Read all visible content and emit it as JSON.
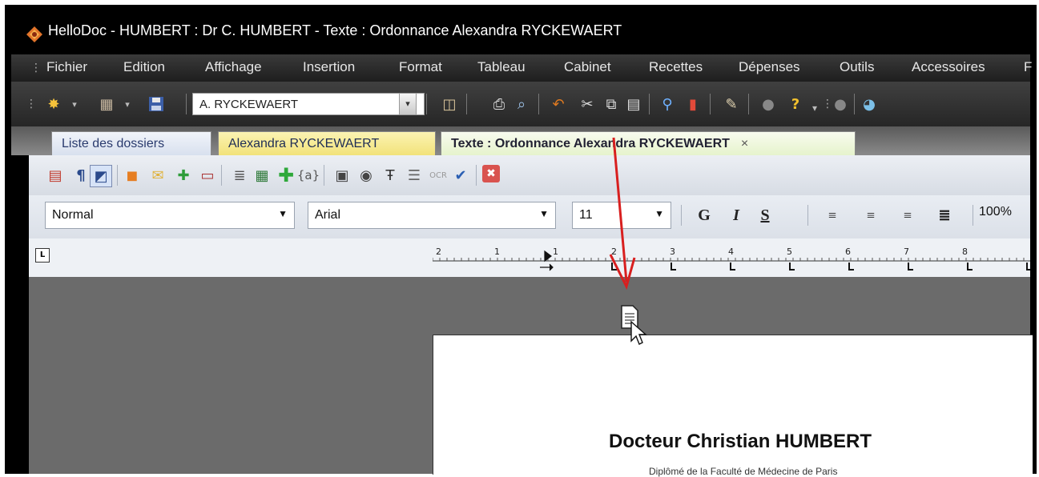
{
  "window": {
    "title": "HelloDoc - HUMBERT : Dr C. HUMBERT - Texte : Ordonnance Alexandra RYCKEWAERT"
  },
  "menu": {
    "items": [
      "Fichier",
      "Edition",
      "Affichage",
      "Insertion",
      "Format",
      "Tableau",
      "Cabinet",
      "Recettes",
      "Dépenses",
      "Outils",
      "Accessoires",
      "F"
    ]
  },
  "toolbar": {
    "patient_combo_value": "A. RYCKEWAERT"
  },
  "tabs": [
    {
      "label": "Liste des dossiers"
    },
    {
      "label": "Alexandra RYCKEWAERT"
    },
    {
      "label": "Texte : Ordonnance Alexandra RYCKEWAERT",
      "close": "×"
    }
  ],
  "format": {
    "style": "Normal",
    "font": "Arial",
    "size": "11",
    "bold": "G",
    "italic": "I",
    "underline": "S",
    "zoom": "100%"
  },
  "ruler": {
    "tab_selector": "L",
    "labels": [
      "2",
      "1",
      "1",
      "2",
      "3",
      "4",
      "5",
      "6",
      "7",
      "8"
    ]
  },
  "document": {
    "heading": "Docteur Christian HUMBERT",
    "subheading": "Diplômé de la Faculté de Médecine de Paris"
  },
  "colors": {
    "annotation_arrow": "#d81f1f",
    "tab_patient": "#f2e27a",
    "tab_text": "#e6f3cc",
    "doc_background": "#6b6b6b"
  }
}
